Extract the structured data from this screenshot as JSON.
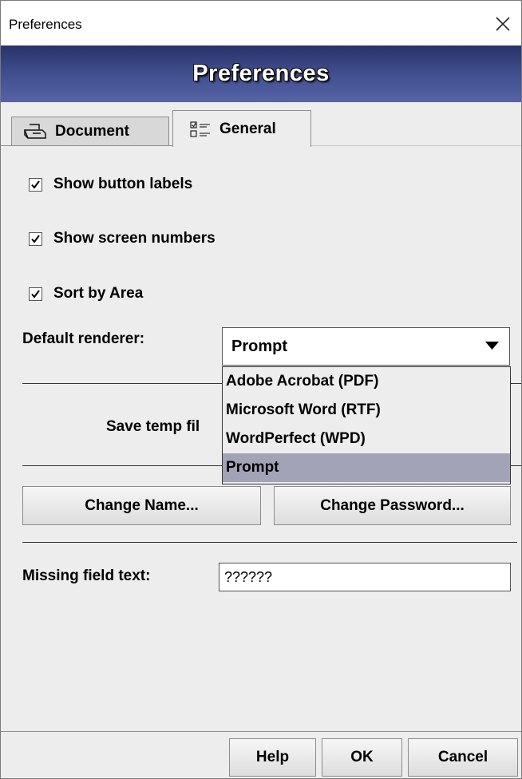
{
  "window": {
    "title": "Preferences"
  },
  "banner": {
    "title": "Preferences"
  },
  "tabs": [
    {
      "label": "Document",
      "icon": "printer-icon"
    },
    {
      "label": "General",
      "icon": "checklist-icon"
    }
  ],
  "general": {
    "checkboxes": [
      {
        "label": "Show button labels",
        "checked": true
      },
      {
        "label": "Show screen numbers",
        "checked": true
      },
      {
        "label": "Sort by Area",
        "checked": true
      }
    ],
    "default_renderer_label": "Default renderer:",
    "default_renderer_value": "Prompt",
    "renderer_options": [
      "Adobe Acrobat (PDF)",
      "Microsoft Word (RTF)",
      "WordPerfect (WPD)",
      "Prompt"
    ],
    "save_temp_label": "Save temp fil",
    "change_name_button": "Change Name...",
    "change_password_button": "Change Password...",
    "missing_field_label": "Missing field text:",
    "missing_field_value": "??????"
  },
  "footer": {
    "help_button": "Help",
    "ok_button": "OK",
    "cancel_button": "Cancel"
  },
  "colors": {
    "banner_top": "#29336a",
    "banner_bottom": "#5564a6",
    "panel_bg": "#ededed",
    "dropdown_selected": "#a3a3b8"
  }
}
